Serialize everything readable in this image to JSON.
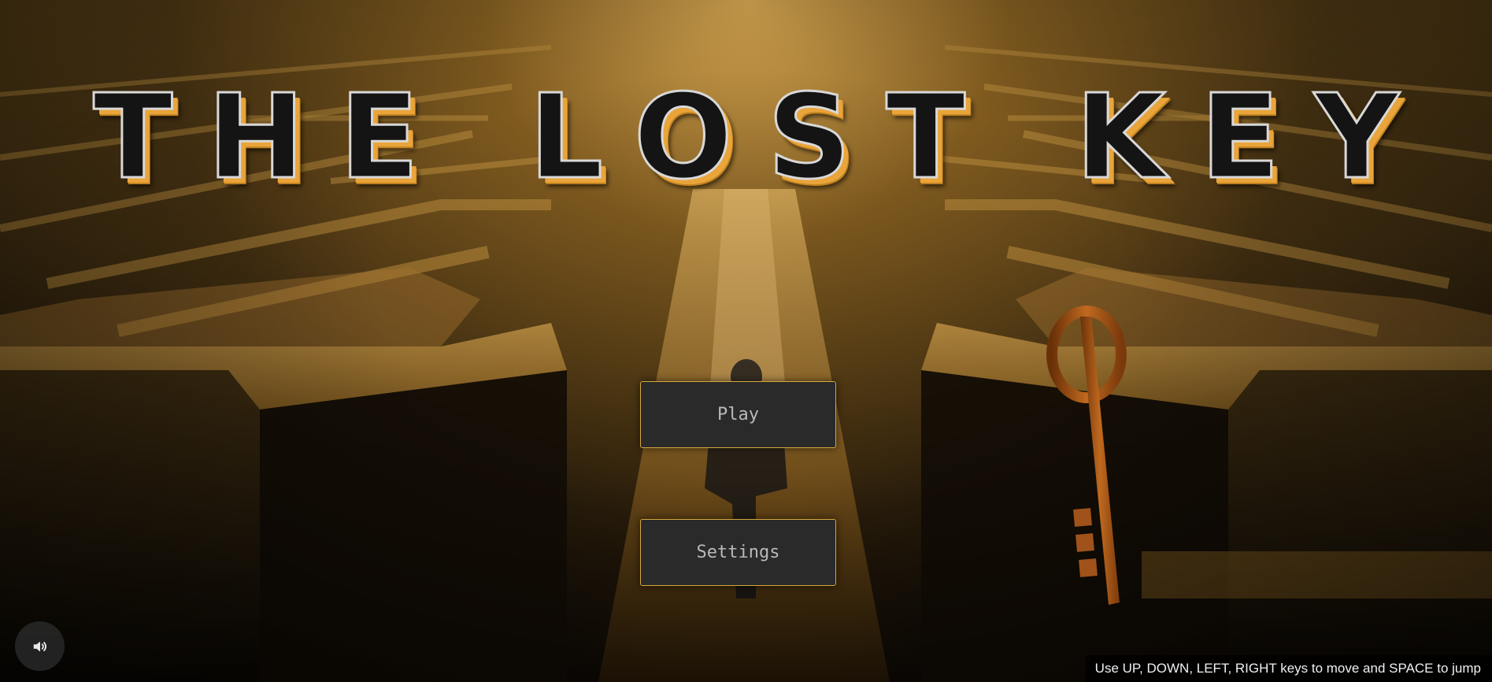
{
  "game": {
    "title": "THE LOST KEY"
  },
  "menu": {
    "play_label": "Play",
    "settings_label": "Settings"
  },
  "controls": {
    "sound_icon": "speaker-volume-icon",
    "instructions": "Use UP, DOWN, LEFT, RIGHT keys to move and SPACE to jump"
  },
  "colors": {
    "accent": "#e9a43a",
    "button_bg": "#2a2a2a",
    "button_border": "#d6a93a",
    "key": "#b5601c"
  }
}
